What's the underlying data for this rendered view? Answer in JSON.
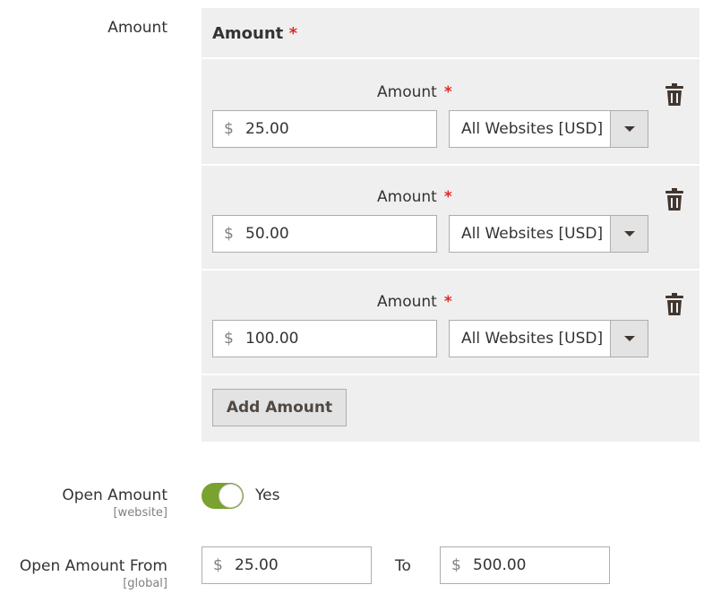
{
  "amount_field": {
    "label": "Amount",
    "box_title": "Amount",
    "required_mark": "*",
    "rows": [
      {
        "label": "Amount",
        "currency": "$",
        "value": "25.00",
        "website": "All Websites [USD]"
      },
      {
        "label": "Amount",
        "currency": "$",
        "value": "50.00",
        "website": "All Websites [USD]"
      },
      {
        "label": "Amount",
        "currency": "$",
        "value": "100.00",
        "website": "All Websites [USD]"
      }
    ],
    "add_button": "Add Amount"
  },
  "open_amount": {
    "label": "Open Amount",
    "scope": "[website]",
    "toggle_label": "Yes",
    "enabled": true
  },
  "open_amount_from": {
    "label": "Open Amount From",
    "scope": "[global]",
    "from_currency": "$",
    "from_value": "25.00",
    "to_label": "To",
    "to_currency": "$",
    "to_value": "500.00"
  },
  "icons": {
    "delete": "trash-icon",
    "dropdown": "chevron-down-icon"
  },
  "colors": {
    "required": "#e02b27",
    "toggle_on": "#79a22e",
    "panel_bg": "#efefef"
  }
}
